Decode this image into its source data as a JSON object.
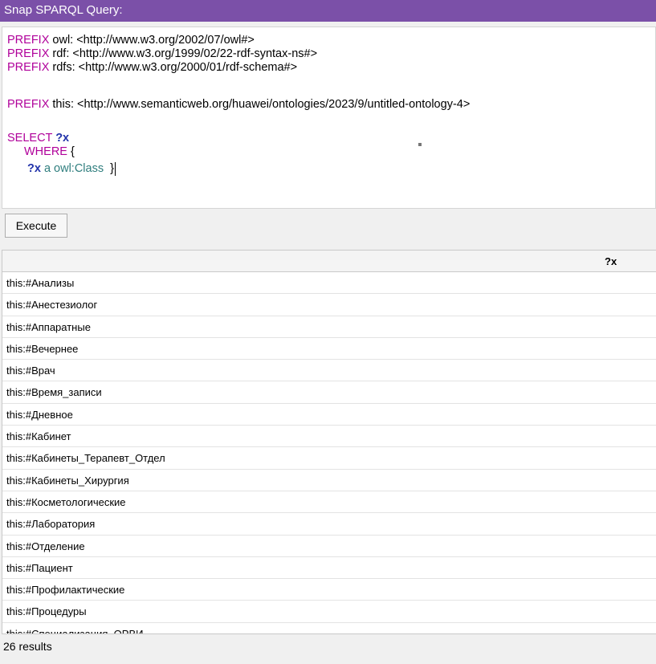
{
  "window": {
    "title": "Snap SPARQL Query:"
  },
  "query": {
    "prefixes": [
      {
        "keyword": "PREFIX",
        "rest": " owl: <http://www.w3.org/2002/07/owl#>"
      },
      {
        "keyword": "PREFIX",
        "rest": " rdf: <http://www.w3.org/1999/02/22-rdf-syntax-ns#>"
      },
      {
        "keyword": "PREFIX",
        "rest": " rdfs: <http://www.w3.org/2000/01/rdf-schema#>"
      },
      {
        "keyword": "PREFIX",
        "rest": " this: <http://www.semanticweb.org/huawei/ontologies/2023/9/untitled-ontology-4>"
      }
    ],
    "select_keyword": "SELECT",
    "select_var": "?x",
    "where_keyword": "WHERE",
    "where_brace": " {",
    "pattern_var": "?x",
    "pattern_a": " a ",
    "pattern_class": "owl:Class",
    "pattern_close": "  }"
  },
  "toolbar": {
    "execute_label": "Execute"
  },
  "results": {
    "column_header": "?x",
    "rows": [
      "this:#Анализы",
      "this:#Анестезиолог",
      "this:#Аппаратные",
      "this:#Вечернее",
      "this:#Врач",
      "this:#Время_записи",
      "this:#Дневное",
      "this:#Кабинет",
      "this:#Кабинеты_Терапевт_Отдел",
      "this:#Кабинеты_Хирургия",
      "this:#Косметологические",
      "this:#Лаборатория",
      "this:#Отделение",
      "this:#Пациент",
      "this:#Профилактические",
      "this:#Процедуры",
      "this:#Специализация_ОРВИ"
    ]
  },
  "status": {
    "count_text": "26 results"
  },
  "colors": {
    "titlebar": "#7b50a8",
    "keyword": "#b0009a",
    "variable": "#2233aa",
    "owl_class": "#2f7e7e"
  }
}
